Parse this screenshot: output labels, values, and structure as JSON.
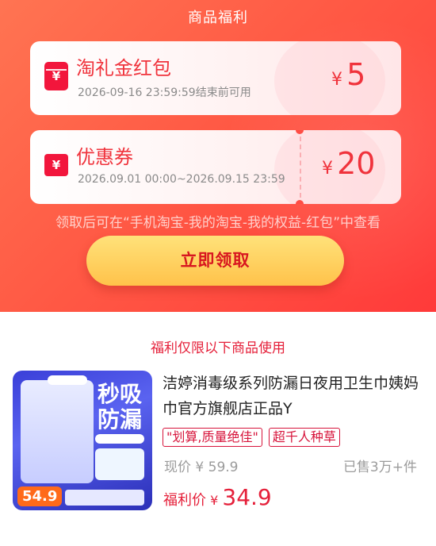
{
  "header": {
    "title": "商品福利"
  },
  "coupons": [
    {
      "title": "淘礼金红包",
      "subtitle": "2026-09-16 23:59:59结束前可用",
      "currency": "¥",
      "amount": "5",
      "icon": "red-envelope-icon"
    },
    {
      "title": "优惠券",
      "subtitle": "2026.09.01 00:00~2026.09.15 23:59",
      "currency": "¥",
      "amount": "20",
      "icon": "coupon-ticket-icon"
    }
  ],
  "note": "领取后可在“手机淘宝-我的淘宝-我的权益-红包”中查看",
  "claim_button": "立即领取",
  "section_label": "福利仅限以下商品使用",
  "product": {
    "image": {
      "headline": "秒吸防漏",
      "price_tag": "54.9"
    },
    "title": "洁婷消毒级系列防漏日夜用卫生巾姨妈巾官方旗舰店正品Y",
    "tags": [
      "\"划算,质量绝佳\"",
      "超千人种草"
    ],
    "current_price": "现价 ¥ 59.9",
    "sold": "已售3万+件",
    "welfare_label": "福利价",
    "welfare_currency": "¥",
    "welfare_price": "34.9"
  },
  "colors": {
    "accent": "#f0333c",
    "button": "#ffc24a",
    "hero": "#ff5a45"
  }
}
